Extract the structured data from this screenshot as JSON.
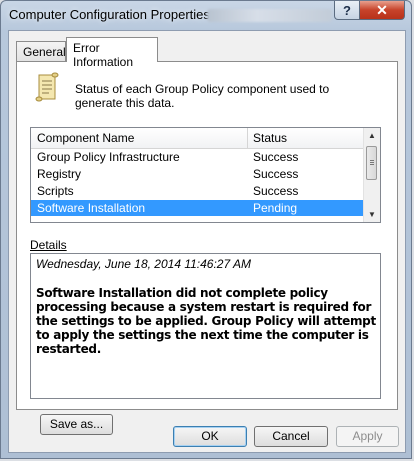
{
  "window": {
    "title": "Computer Configuration Properties",
    "help_glyph": "?",
    "close_glyph": "✕"
  },
  "tabs": [
    {
      "label": "General",
      "selected": false
    },
    {
      "label": "Error Information",
      "selected": true
    }
  ],
  "panel": {
    "description": "Status of each Group Policy component used to generate this data.",
    "list": {
      "columns": [
        "Component Name",
        "Status"
      ],
      "rows": [
        {
          "name": "Group Policy Infrastructure",
          "status": "Success",
          "selected": false
        },
        {
          "name": "Registry",
          "status": "Success",
          "selected": false
        },
        {
          "name": "Scripts",
          "status": "Success",
          "selected": false
        },
        {
          "name": "Software Installation",
          "status": "Pending",
          "selected": true
        }
      ]
    },
    "details_label": "Details",
    "details_timestamp": "Wednesday, June 18, 2014 11:46:27 AM",
    "details_message": "Software Installation did not complete policy processing because a system restart is required for the settings to be applied.  Group Policy will attempt to apply the settings the next time the computer is restarted."
  },
  "buttons": {
    "save_as": "Save as...",
    "ok": "OK",
    "cancel": "Cancel",
    "apply": "Apply"
  },
  "colors": {
    "selection": "#3399ff",
    "close_button": "#c7432a"
  },
  "icons": {
    "panel": "scroll-document-icon",
    "scroll_up": "scroll-up-arrow-icon",
    "scroll_down": "scroll-down-arrow-icon"
  }
}
